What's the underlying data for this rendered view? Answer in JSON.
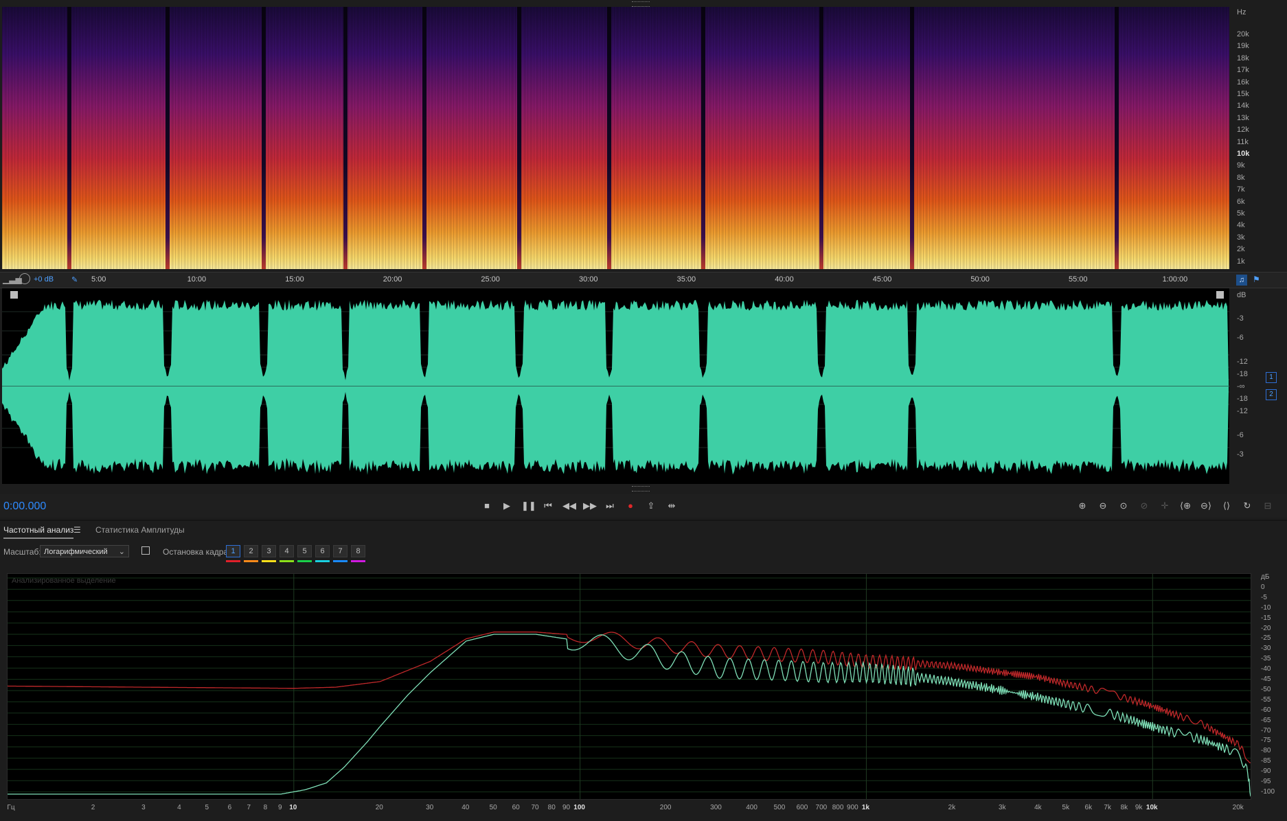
{
  "spectrogram": {
    "unit_label": "Hz",
    "freq_ticks": [
      "20k",
      "19k",
      "18k",
      "17k",
      "16k",
      "15k",
      "14k",
      "13k",
      "12k",
      "11k",
      "10k",
      "9k",
      "8k",
      "7k",
      "6k",
      "5k",
      "4k",
      "3k",
      "2k",
      "1k"
    ]
  },
  "timeline": {
    "gain_label": "+0 dB",
    "ticks": [
      "5:00",
      "10:00",
      "15:00",
      "20:00",
      "25:00",
      "30:00",
      "35:00",
      "40:00",
      "45:00",
      "50:00",
      "55:00",
      "1:00:00"
    ]
  },
  "waveform": {
    "db_label": "dB",
    "db_ticks_top": [
      "-3",
      "-6",
      "-12",
      "-18",
      "-∞"
    ],
    "db_ticks_bottom": [
      "-18",
      "-12",
      "-6",
      "-3"
    ],
    "channels": [
      "1",
      "2"
    ],
    "color": "#3ecfa5"
  },
  "transport": {
    "time": "0:00.000"
  },
  "panel": {
    "tabs": [
      "Частотный анализ",
      "Статистика Амплитуды"
    ],
    "scale_label": "Масштаб:",
    "scale_value": "Логарифмический",
    "freeze_label": "Остановка кадра:",
    "frames": [
      "1",
      "2",
      "3",
      "4",
      "5",
      "6",
      "7",
      "8"
    ],
    "frame_colors": [
      "#e0202a",
      "#ff8a1a",
      "#ffe01a",
      "#8ce01a",
      "#1ad04a",
      "#1ad0e0",
      "#1a8aff",
      "#d01ae0"
    ]
  },
  "chart_data": {
    "type": "line",
    "title": "Анализированное выделение",
    "xlabel": "Гц",
    "ylabel": "дБ",
    "xscale": "log",
    "xlim": [
      1,
      22000
    ],
    "ylim": [
      -100,
      0
    ],
    "x_tick_labels": [
      "Гц",
      "2",
      "3",
      "4",
      "5",
      "6",
      "7",
      "8",
      "9",
      "10",
      "20",
      "30",
      "40",
      "50",
      "60",
      "70",
      "80",
      "90",
      "100",
      "200",
      "300",
      "400",
      "500",
      "600",
      "700",
      "800",
      "900",
      "1k",
      "2k",
      "3k",
      "4k",
      "5k",
      "6k",
      "7k",
      "8k",
      "9k",
      "10k",
      "20k"
    ],
    "y_tick_labels": [
      "дБ",
      "0",
      "-5",
      "-10",
      "-15",
      "-20",
      "-25",
      "-30",
      "-35",
      "-40",
      "-45",
      "-50",
      "-55",
      "-60",
      "-65",
      "-70",
      "-75",
      "-80",
      "-85",
      "-90",
      "-95",
      "-100"
    ],
    "series": [
      {
        "color": "#c0282a",
        "x": [
          1,
          3,
          10,
          14,
          20,
          30,
          40,
          50,
          70,
          100,
          150,
          200,
          300,
          500,
          700,
          1000,
          1500,
          2000,
          3000,
          4000,
          5000,
          7000,
          10000,
          15000,
          20000,
          22000
        ],
        "y": [
          -48,
          -48.5,
          -49,
          -48.5,
          -46,
          -37,
          -27,
          -24,
          -24,
          -25.5,
          -28,
          -30,
          -32.5,
          -34,
          -35,
          -37,
          -38,
          -39,
          -42,
          -44,
          -47,
          -51,
          -57,
          -65,
          -74,
          -82
        ]
      },
      {
        "color": "#7fe0b8",
        "x": [
          1,
          3,
          9,
          11,
          13,
          15,
          18,
          20,
          25,
          30,
          40,
          50,
          70,
          100,
          150,
          200,
          300,
          500,
          700,
          1000,
          1500,
          2000,
          3000,
          4000,
          5000,
          7000,
          10000,
          15000,
          20000,
          21500,
          22000
        ],
        "y": [
          -96,
          -96,
          -96,
          -94,
          -91,
          -84,
          -73,
          -66,
          -52,
          -42,
          -28,
          -25,
          -25,
          -28,
          -32,
          -36,
          -40,
          -41,
          -42,
          -42,
          -44,
          -46,
          -50,
          -53,
          -56,
          -60,
          -66,
          -72,
          -78,
          -86,
          -97
        ]
      }
    ]
  }
}
